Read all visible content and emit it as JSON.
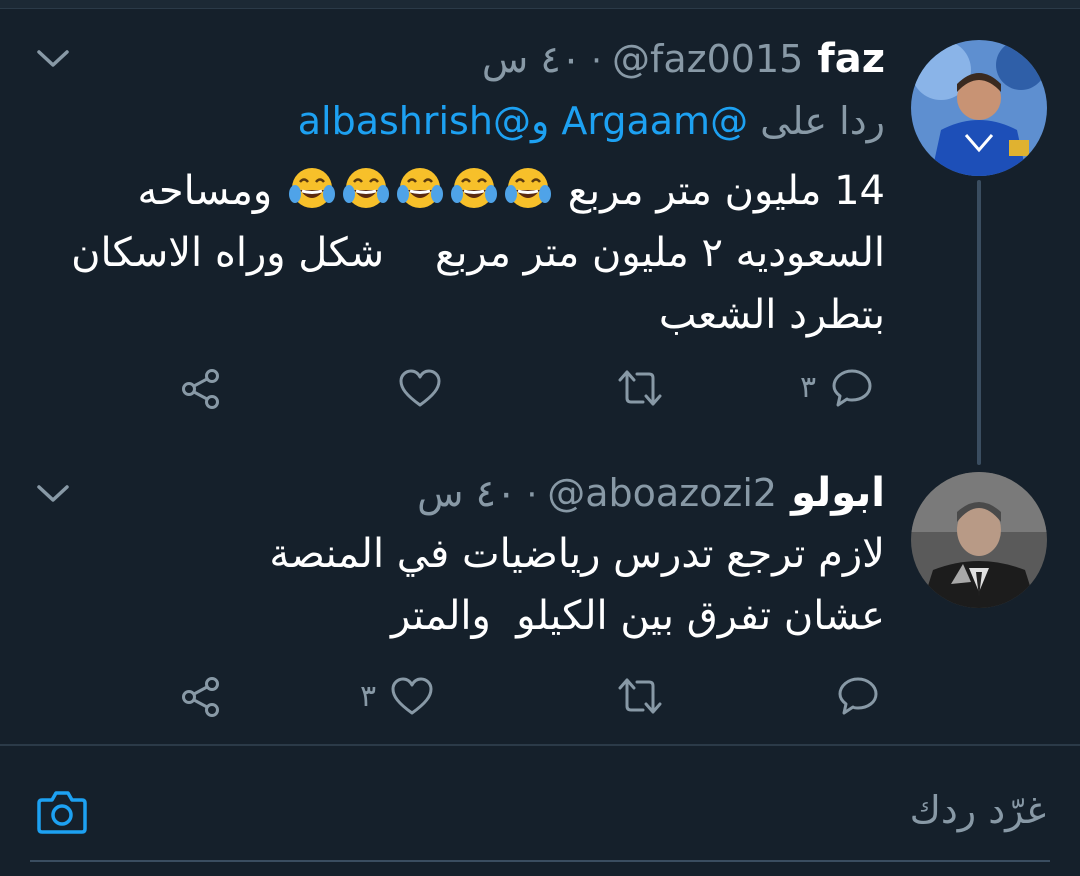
{
  "tweets": [
    {
      "name": "faz",
      "handle": "@faz0015",
      "dot": "·",
      "time": "٤٠ س",
      "reply_prefix": "ردا على",
      "reply_mention_1": "@Argaam",
      "reply_and": "و",
      "reply_mention_2": "@albashrish",
      "line1_start": "14 مليون متر مربع",
      "line1_end": "ومساحه",
      "line2": "السعوديه ٢ مليون متر مربع    شكل وراه الاسكان",
      "line3": "بتطرد الشعب",
      "reply_count": "٣",
      "like_count": ""
    },
    {
      "name": "ابولو",
      "handle": "@aboazozi2",
      "dot": "·",
      "time": "٤٠ س",
      "line1": "لازم ترجع تدرس رياضيات في المنصة",
      "line2": "عشان تفرق بين الكيلو  والمتر",
      "reply_count": "",
      "like_count": "٣"
    }
  ],
  "emoji_name": "face-with-tears-of-joy",
  "compose": {
    "placeholder": "غرّد ردك"
  },
  "colors": {
    "background": "#15202b",
    "accent": "#1da1f2",
    "muted": "#8899a6",
    "text": "#ffffff"
  }
}
